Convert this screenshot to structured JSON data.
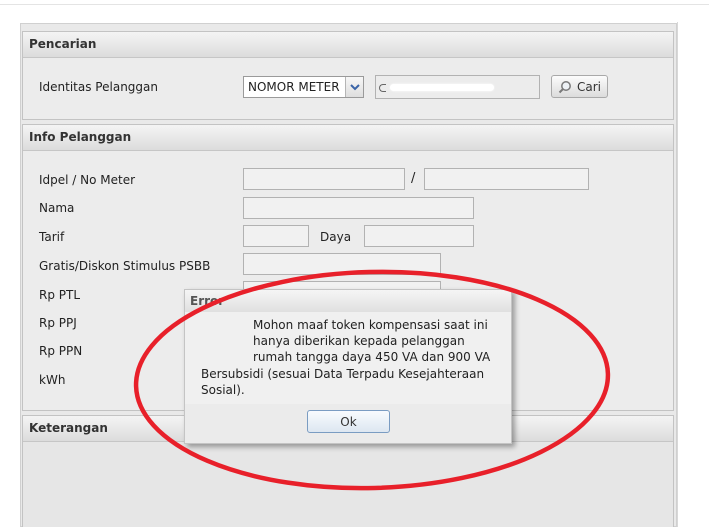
{
  "search": {
    "title": "Pencarian",
    "label": "Identitas Pelanggan",
    "select_value": "NOMOR METER",
    "input_value": "",
    "button_label": "Cari"
  },
  "info": {
    "title": "Info Pelanggan",
    "labels": {
      "idpel": "Idpel / No Meter",
      "separator": "/",
      "nama": "Nama",
      "tarif": "Tarif",
      "daya": "Daya",
      "gratis": "Gratis/Diskon Stimulus PSBB",
      "ptl": "Rp PTL",
      "ppj": "Rp PPJ",
      "ppn": "Rp PPN",
      "kwh": "kWh"
    }
  },
  "keterangan": {
    "title": "Keterangan"
  },
  "dialog": {
    "title": "Error",
    "lines": [
      "Mohon maaf token kompensasi saat ini",
      "hanya diberikan kepada pelanggan",
      "rumah tangga daya 450 VA dan 900 VA",
      "Bersubsidi (sesuai Data Terpadu Kesejahteraan",
      "Sosial)."
    ],
    "ok_label": "Ok"
  },
  "colors": {
    "annotation_oval": "#e8202a",
    "panel_bg": "#ececec",
    "dialog_button_border": "#7a9cc2"
  }
}
